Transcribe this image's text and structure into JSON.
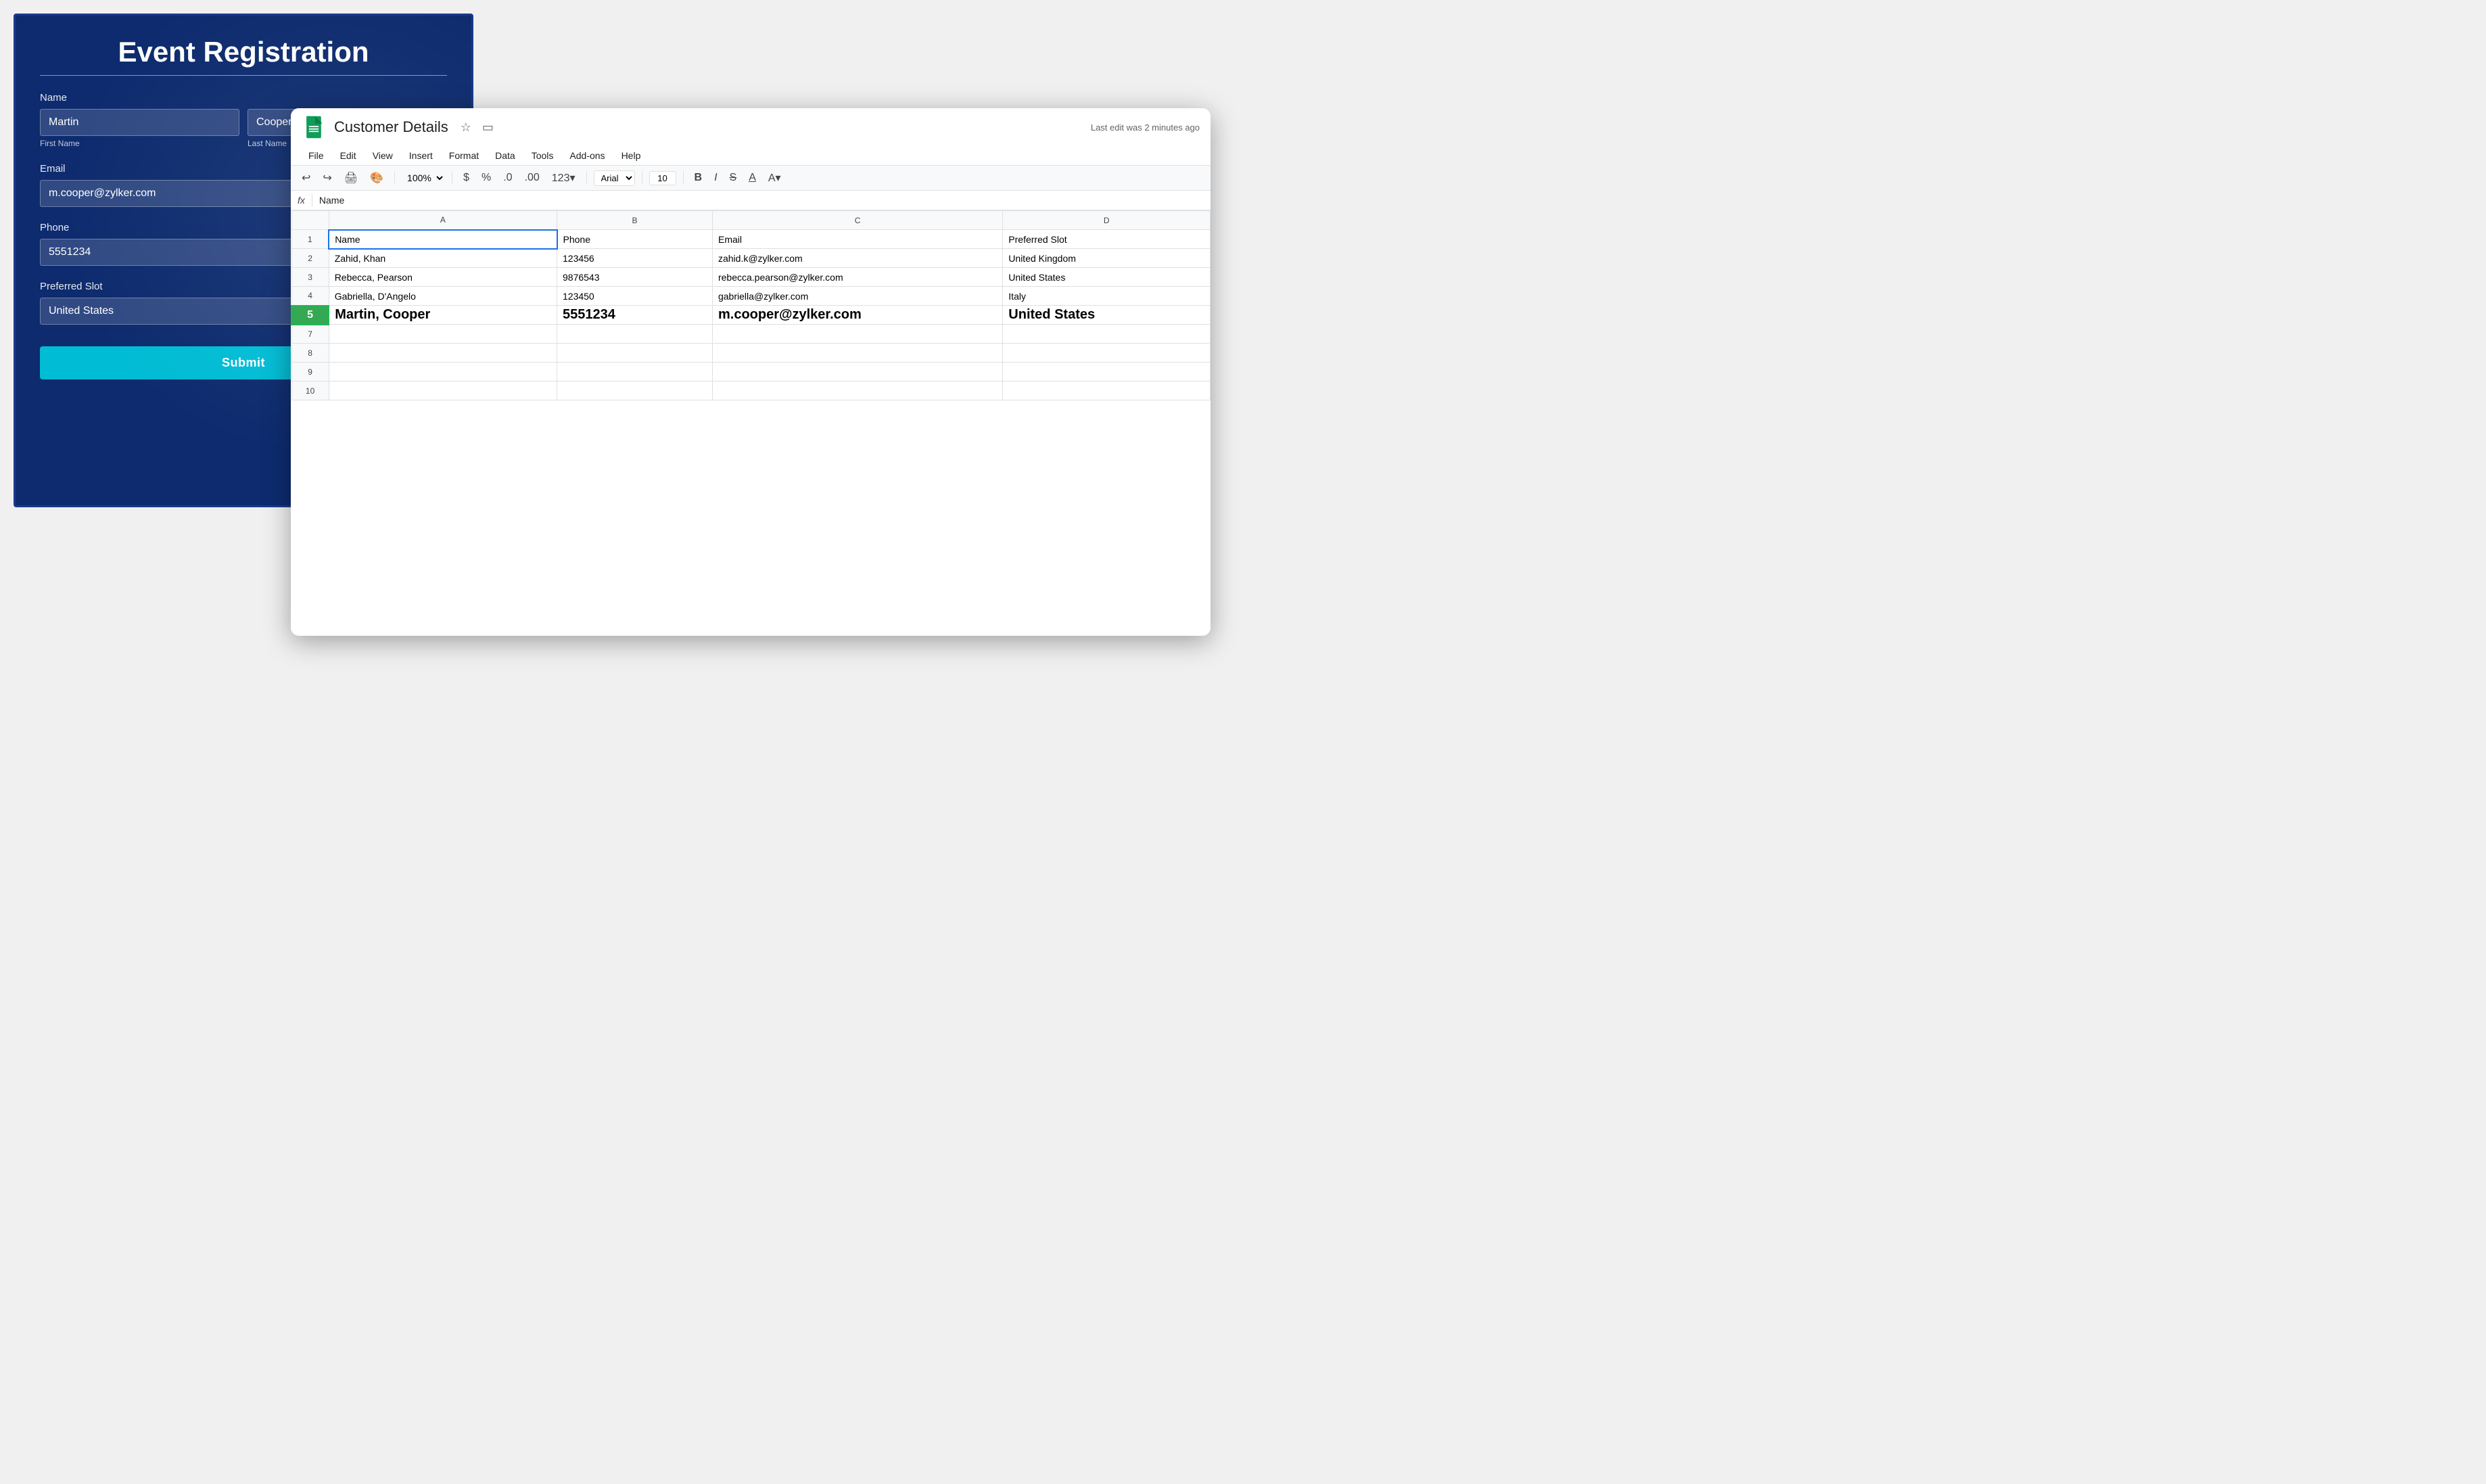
{
  "form": {
    "title": "Event Registration",
    "name_label": "Name",
    "first_name_label": "First Name",
    "last_name_label": "Last Name",
    "first_name_value": "Martin",
    "last_name_value": "Cooper",
    "email_label": "Email",
    "email_value": "m.cooper@zylker.com",
    "phone_label": "Phone",
    "phone_value": "5551234",
    "preferred_slot_label": "Preferred Slot",
    "preferred_slot_value": "United States",
    "submit_label": "Submit"
  },
  "sheets": {
    "title": "Customer Details",
    "last_edit": "Last edit was 2 minutes ago",
    "formula_cell": "Name",
    "menu": [
      "File",
      "Edit",
      "View",
      "Insert",
      "Format",
      "Data",
      "Tools",
      "Add-ons",
      "Help"
    ],
    "zoom": "100%",
    "font": "Arial",
    "font_size": "10",
    "col_headers": [
      "A",
      "B",
      "C",
      "D"
    ],
    "headers": [
      "Name",
      "Phone",
      "Email",
      "Preferred Slot"
    ],
    "rows": [
      {
        "num": "2",
        "name": "Zahid, Khan",
        "phone": "123456",
        "email": "zahid.k@zylker.com",
        "slot": "United Kingdom"
      },
      {
        "num": "3",
        "name": "Rebecca, Pearson",
        "phone": "9876543",
        "email": "rebecca.pearson@zylker.com",
        "slot": "United States"
      },
      {
        "num": "4",
        "name": "Gabriella, D'Angelo",
        "phone": "123450",
        "email": "gabriella@zylker.com",
        "slot": "Italy"
      }
    ],
    "highlight_row": {
      "num": "5",
      "name": "Martin, Cooper",
      "phone": "5551234",
      "email": "m.cooper@zylker.com",
      "slot": "United States"
    },
    "empty_rows": [
      "7",
      "8",
      "9",
      "10"
    ]
  }
}
